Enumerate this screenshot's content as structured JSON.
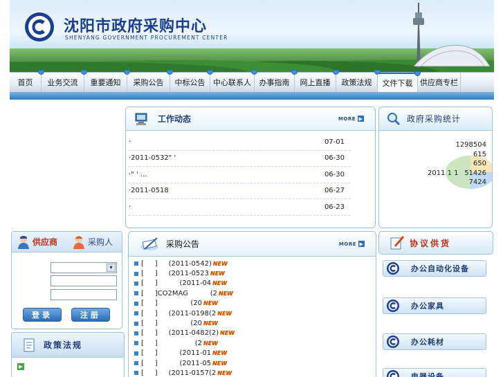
{
  "banner": {
    "title_cn": "沈阳市政府采购中心",
    "title_en": "SHENYANG GOVERNMENT PROCUREMENT CENTER",
    "logo_icon": "procurement-center-logo"
  },
  "nav": {
    "items": [
      {
        "label": "首页",
        "width": 46
      },
      {
        "label": "业务交流",
        "width": 62
      },
      {
        "label": "重要通知",
        "width": 62
      },
      {
        "label": "采购公告",
        "width": 62
      },
      {
        "label": "中标公告",
        "width": 58
      },
      {
        "label": "中心联系人",
        "width": 64
      },
      {
        "label": "办事指南",
        "width": 58
      },
      {
        "label": "网上直播",
        "width": 60
      },
      {
        "label": "政策法规",
        "width": 60
      },
      {
        "label": "文件下载",
        "width": 58
      },
      {
        "label": "供应商专栏",
        "width": 62
      }
    ]
  },
  "work_news": {
    "title": "工作动态",
    "more": "MORE",
    "items": [
      {
        "text": "·",
        "date": "07-01"
      },
      {
        "text": "·2011-0532\"     '",
        "date": "06-30"
      },
      {
        "text": "·\"            '  ...",
        "date": "06-30"
      },
      {
        "text": "·2011-0518",
        "date": "06-27"
      },
      {
        "text": "·",
        "date": "06-23"
      }
    ]
  },
  "stats": {
    "title": "政府采购统计",
    "values": [
      "1298504",
      "615",
      "650",
      "51426",
      "7424"
    ],
    "year_text": "2011 1 1"
  },
  "announcements": {
    "title": "采购公告",
    "more": "MORE",
    "new_label": "NEW",
    "items": [
      {
        "text": "[     ]     (2011-0542)"
      },
      {
        "text": "[     ]     (2011-0523"
      },
      {
        "text": "[     ]          (2011-04"
      },
      {
        "text": "[     ]CO2MAG          (2"
      },
      {
        "text": "[     ]               (20"
      },
      {
        "text": "[     ]     (2011-0198(2"
      },
      {
        "text": "[     ]               (20"
      },
      {
        "text": "[     ]     (2011-0482(2)"
      },
      {
        "text": "[     ]                 (2"
      },
      {
        "text": "[     ]          (2011-01"
      },
      {
        "text": "[     ]          (2011-05"
      },
      {
        "text": "[     ]     (2011-0157(2"
      }
    ]
  },
  "login": {
    "tab_supplier": "供应商",
    "tab_buyer": "采购人",
    "login_label": "登录",
    "register_label": "注册"
  },
  "policy": {
    "title": "政策法规"
  },
  "supply": {
    "title": "协议供货",
    "items": [
      {
        "label": "办公自动化设备"
      },
      {
        "label": "办公家具"
      },
      {
        "label": "办公耗材"
      },
      {
        "label": "电器设备"
      }
    ]
  },
  "colors": {
    "brand_blue": "#1a3f8f",
    "accent_blue": "#2f79c2",
    "new_red": "#e23b00"
  }
}
